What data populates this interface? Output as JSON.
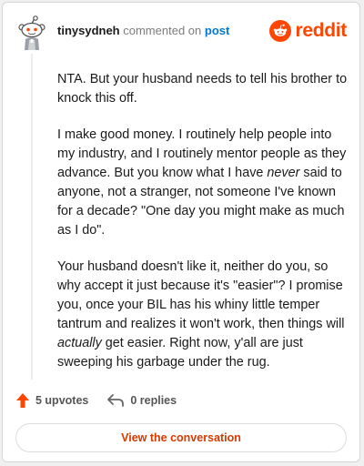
{
  "comment": {
    "username": "tinysydneh",
    "action_text": "commented on",
    "post_link": "post",
    "paragraphs": [
      [
        {
          "text": "NTA. But your husband needs to tell his brother to knock this off.",
          "em": false
        }
      ],
      [
        {
          "text": "I make good money. I routinely help people into my industry, and I routinely mentor people as they advance. But you know what I have ",
          "em": false
        },
        {
          "text": "never",
          "em": true
        },
        {
          "text": " said to anyone, not a stranger, not someone I've known for a decade? \"One day you might make as much as I do\".",
          "em": false
        }
      ],
      [
        {
          "text": "Your husband doesn't like it, neither do you, so why accept it just because it's \"easier\"? I promise you, once your BIL has his whiny little temper tantrum and realizes it won't work, then things will ",
          "em": false
        },
        {
          "text": "actually",
          "em": true
        },
        {
          "text": " get easier. Right now, y'all are just sweeping his garbage under the rug.",
          "em": false
        }
      ]
    ]
  },
  "brand": {
    "name": "reddit",
    "color": "#ff4500"
  },
  "actions": {
    "upvotes": "5 upvotes",
    "replies": "0 replies",
    "upvote_icon": "upvote-arrow-icon",
    "reply_icon": "reply-arrow-icon"
  },
  "footer": {
    "view_label": "View the conversation"
  },
  "colors": {
    "accent": "#d93a00",
    "upvote": "#ff4500",
    "link": "#0079d3"
  }
}
